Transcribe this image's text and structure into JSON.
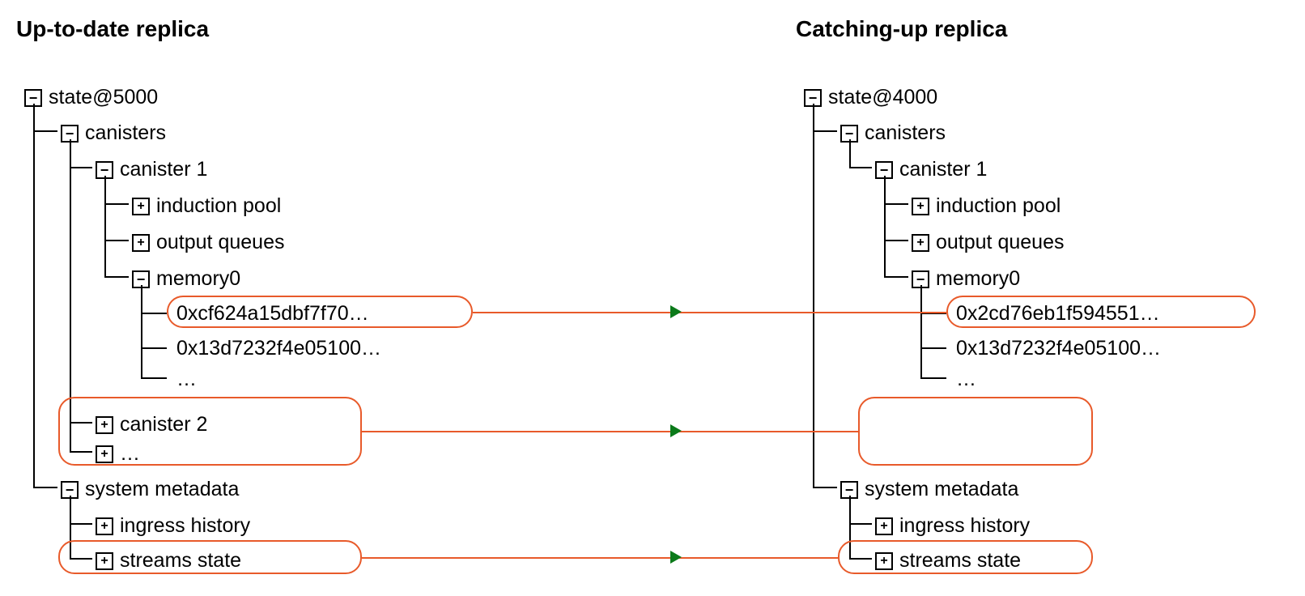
{
  "left": {
    "title": "Up-to-date replica",
    "root": "state@5000",
    "canisters": "canisters",
    "can1": "canister 1",
    "induction": "induction pool",
    "output": "output queues",
    "mem0": "memory0",
    "hash1": "0xcf624a15dbf7f70…",
    "hash2": "0x13d7232f4e05100…",
    "dots": "…",
    "can2": "canister 2",
    "can_dots": "…",
    "sysmeta": "system metadata",
    "ingress": "ingress history",
    "streams": "streams state"
  },
  "right": {
    "title": "Catching-up replica",
    "root": "state@4000",
    "canisters": "canisters",
    "can1": "canister 1",
    "induction": "induction pool",
    "output": "output queues",
    "mem0": "memory0",
    "hash1": "0x2cd76eb1f594551…",
    "hash2": "0x13d7232f4e05100…",
    "dots": "…",
    "sysmeta": "system metadata",
    "ingress": "ingress history",
    "streams": "streams state"
  }
}
